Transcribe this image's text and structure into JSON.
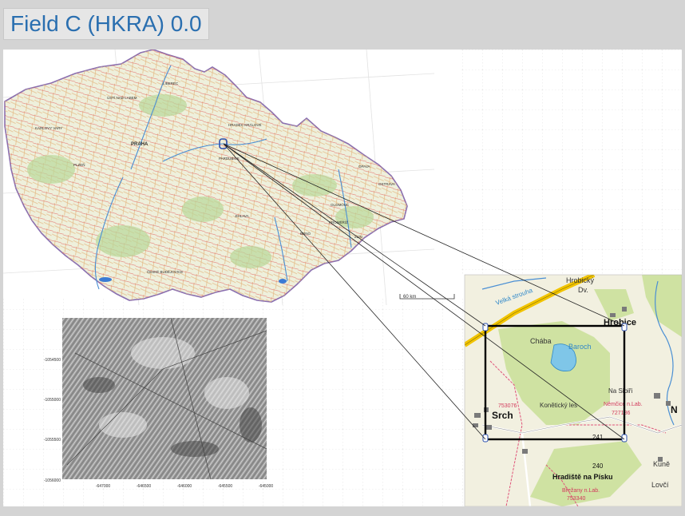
{
  "title": "Field C (HKRA) 0.0",
  "country_map": {
    "scale_bar_label": "60 km",
    "city_labels": [
      "PRAHA",
      "PLZEŇ",
      "BRNO",
      "OSTRAVA",
      "OLOMOUC",
      "ZLÍN",
      "LIBEREC",
      "JIHLAVA",
      "KARLOVY VARY",
      "ČESKÉ BUDĚJOVICE",
      "ÚSTÍ NAD LABEM",
      "HRADEC KRÁLOVÉ",
      "PARDUBICE",
      "OPAVA",
      "KROMĚŘÍŽ"
    ]
  },
  "lidar_panel": {
    "y_ticks": [
      "-1054500",
      "-1055000",
      "-1055500",
      "-1056000"
    ],
    "x_ticks": [
      "-647000",
      "-646500",
      "-646000",
      "-645500",
      "-645000"
    ]
  },
  "detail_map": {
    "labels": {
      "hrobicky": "Hrobický",
      "dv": "Dv.",
      "hrobice": "Hrobice",
      "velka_strouha": "Velká strouha",
      "chaby": "Chába",
      "baroch": "Baroch",
      "na_sibiri": "Na Sibiři",
      "srch": "Srch",
      "konetsky_les": "Konětický les",
      "code1": "753076",
      "nemcice": "Němčice n.Lab.",
      "code2": "727186",
      "elev241": "241",
      "elev240": "240",
      "hradiste": "Hradiště na Písku",
      "brezany": "Břežany n.Lab.",
      "code3": "753340",
      "kune": "Kuně",
      "lovci": "Lovčí",
      "n_letter": "N"
    }
  },
  "colors": {
    "title_text": "#2a6fb0",
    "detail_frame": "#000000"
  }
}
